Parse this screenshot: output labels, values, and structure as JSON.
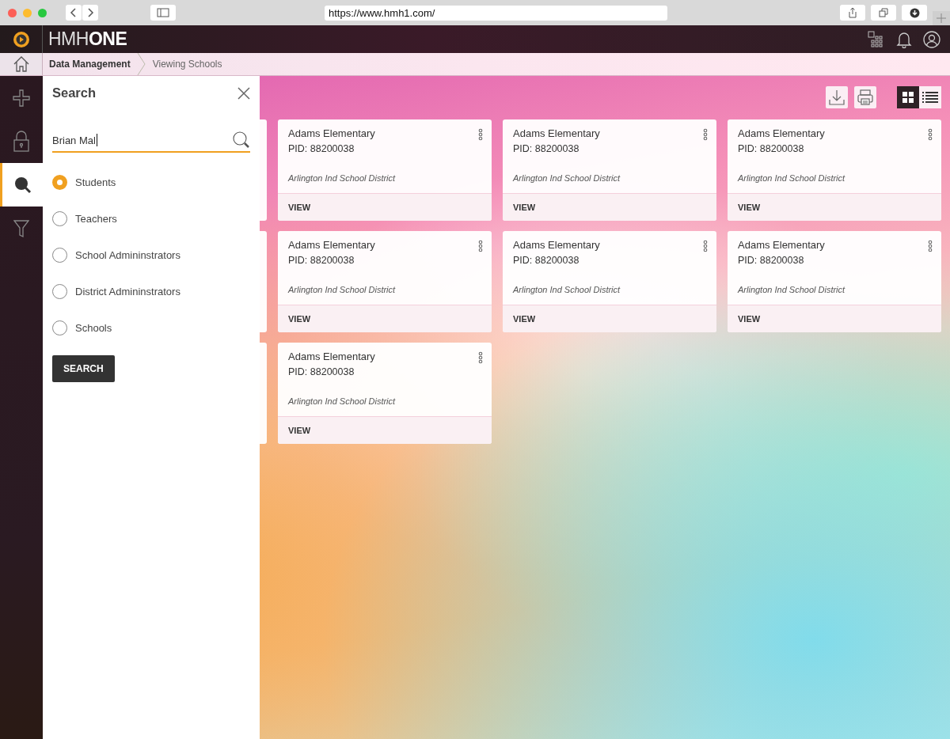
{
  "browser": {
    "url": "https://www.hmh1.com/"
  },
  "app_bar": {
    "logo_light": "HMH",
    "logo_bold": "ONE"
  },
  "breadcrumb": [
    {
      "label": "Data Management",
      "current": false
    },
    {
      "label": "Viewing Schools",
      "current": true
    }
  ],
  "rail": [
    {
      "selected": false
    },
    {
      "selected": false
    },
    {
      "selected": true
    },
    {
      "selected": false
    }
  ],
  "search_panel": {
    "title": "Search",
    "query": "Brian Mal",
    "options": [
      {
        "label": "Students",
        "selected": true
      },
      {
        "label": "Teachers",
        "selected": false
      },
      {
        "label": "School Admininstrators",
        "selected": false
      },
      {
        "label": "District Admininstrators",
        "selected": false
      },
      {
        "label": "Schools",
        "selected": false
      }
    ],
    "button": "SEARCH"
  },
  "view_toggle": [
    {
      "selected": true
    },
    {
      "selected": false
    }
  ],
  "cards": [
    {
      "name": "Adams Elementary",
      "pid_label": "PID:",
      "pid": "88200038",
      "district": "Arlington Ind School District",
      "action": "VIEW"
    },
    {
      "name": "Adams Elementary",
      "pid_label": "PID:",
      "pid": "88200038",
      "district": "Arlington Ind School District",
      "action": "VIEW"
    },
    {
      "name": "Adams Elementary",
      "pid_label": "PID:",
      "pid": "88200038",
      "district": "Arlington Ind School District",
      "action": "VIEW"
    },
    {
      "name": "Adams Elementary",
      "pid_label": "PID:",
      "pid": "88200038",
      "district": "Arlington Ind School District",
      "action": "VIEW"
    },
    {
      "name": "Adams Elementary",
      "pid_label": "PID:",
      "pid": "88200038",
      "district": "Arlington Ind School District",
      "action": "VIEW"
    },
    {
      "name": "Adams Elementary",
      "pid_label": "PID:",
      "pid": "88200038",
      "district": "Arlington Ind School District",
      "action": "VIEW"
    },
    {
      "name": "Adams Elementary",
      "pid_label": "PID:",
      "pid": "88200038",
      "district": "Arlington Ind School District",
      "action": "VIEW"
    }
  ]
}
